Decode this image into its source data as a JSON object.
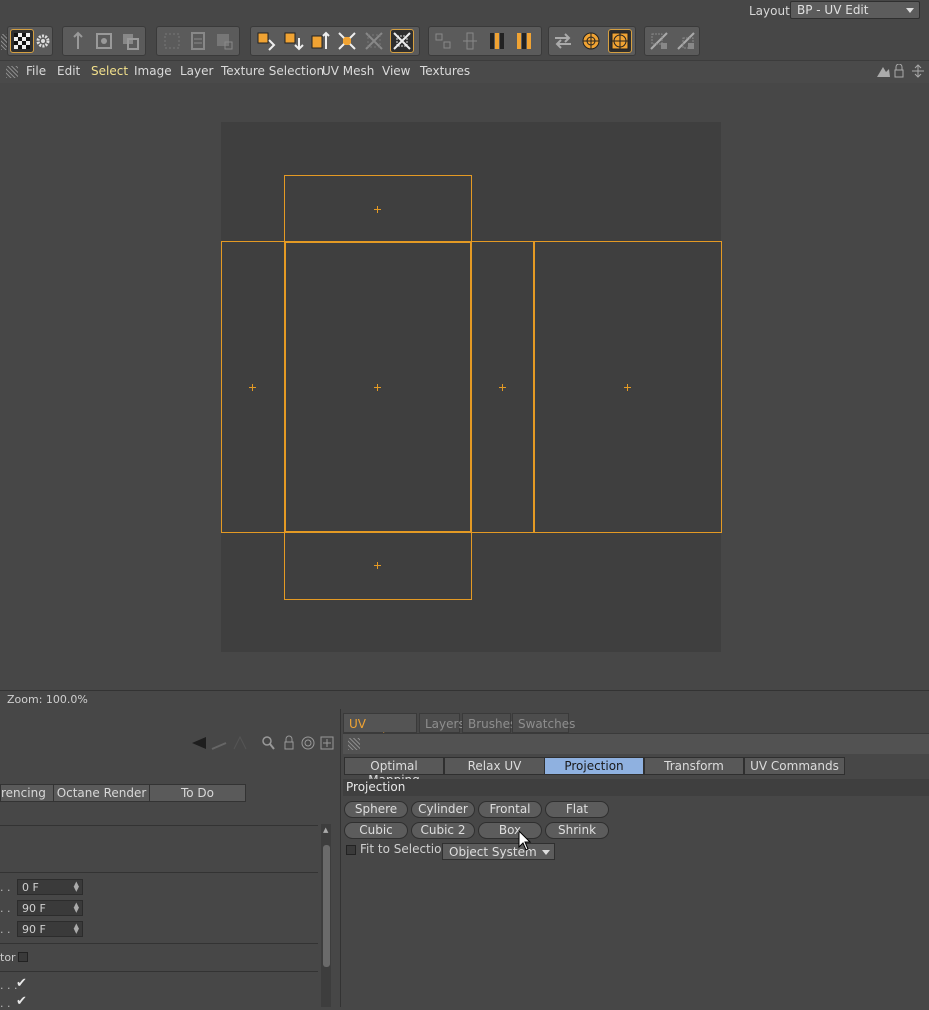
{
  "layout": {
    "label": "Layout:",
    "value": "BP - UV Edit"
  },
  "menu": [
    "File",
    "Edit",
    "Select",
    "Image",
    "Layer",
    "Texture Selection",
    "UV Mesh",
    "View",
    "Textures"
  ],
  "menu_selected": "Select",
  "accent_color": "#e49a24",
  "zoom": "Zoom: 100.0%",
  "left_panel": {
    "tabs": [
      "rencing",
      "Octane Render",
      "To Do"
    ],
    "fields": [
      {
        "dots": ". .",
        "value": "0 F"
      },
      {
        "dots": ". .",
        "value": "90 F"
      },
      {
        "dots": ". .",
        "value": "90 F"
      }
    ],
    "checkbox_label": "tor",
    "check_rows": [
      ". . .",
      ". ."
    ]
  },
  "right_panel": {
    "tabs": [
      "UV Mapping",
      "Layers",
      "Brushes",
      "Swatches"
    ],
    "active_tab": "UV Mapping",
    "subtabs": [
      "Optimal Mapping",
      "Relax UV",
      "Projection",
      "Transform",
      "UV Commands"
    ],
    "active_subtab": "Projection",
    "section_title": "Projection",
    "buttons_row1": [
      "Sphere",
      "Cylinder",
      "Frontal",
      "Flat"
    ],
    "buttons_row2": [
      "Cubic",
      "Cubic 2",
      "Box",
      "Shrink"
    ],
    "fit_label": "Fit to Selection",
    "system_select": "Object System"
  }
}
